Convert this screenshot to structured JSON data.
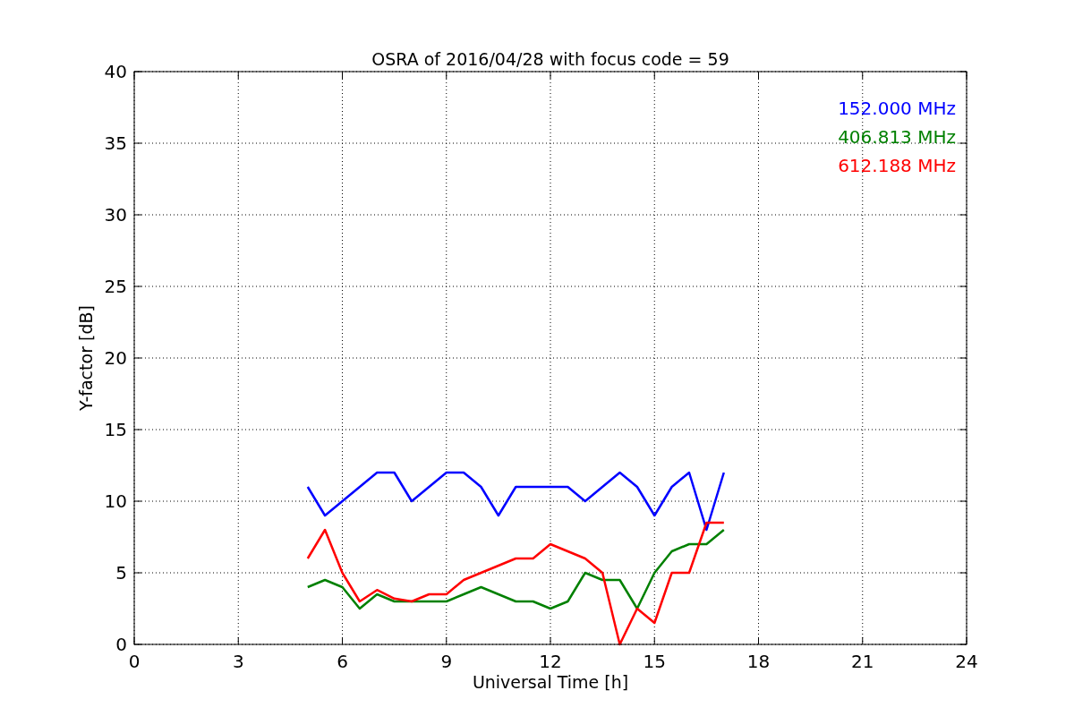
{
  "chart_data": {
    "type": "line",
    "title": "OSRA of 2016/04/28 with focus code = 59",
    "xlabel": "Universal Time [h]",
    "ylabel": "Y-factor [dB]",
    "x": [
      5,
      5.5,
      6,
      6.5,
      7,
      7.5,
      8,
      8.5,
      9,
      9.5,
      10,
      10.5,
      11,
      11.5,
      12,
      12.5,
      13,
      13.5,
      14,
      14.5,
      15,
      15.5,
      16,
      16.5,
      17
    ],
    "series": [
      {
        "name": "152.000 MHz",
        "color": "#0000ff",
        "values": [
          11,
          9,
          10,
          11,
          12,
          12,
          10,
          11,
          12,
          12,
          11,
          9,
          11,
          11,
          11,
          11,
          10,
          11,
          12,
          11,
          9,
          11,
          12,
          8,
          12
        ]
      },
      {
        "name": "406.813 MHz",
        "color": "#008000",
        "values": [
          4,
          4.5,
          4,
          2.5,
          3.5,
          3,
          3,
          3,
          3,
          3.5,
          4,
          3.5,
          3,
          3,
          2.5,
          3,
          5,
          4.5,
          4.5,
          2.5,
          5,
          6.5,
          7,
          7,
          8
        ]
      },
      {
        "name": "612.188 MHz",
        "color": "#ff0000",
        "values": [
          6,
          8,
          5,
          3,
          3.8,
          3.2,
          3,
          3.5,
          3.5,
          4.5,
          5,
          5.5,
          6,
          6,
          7,
          6.5,
          6,
          5,
          0,
          2.5,
          1.5,
          5,
          5,
          8.5,
          8.5
        ]
      }
    ],
    "xlim": [
      0,
      24
    ],
    "ylim": [
      0,
      40
    ],
    "xticks": [
      0,
      3,
      6,
      9,
      12,
      15,
      18,
      21,
      24
    ],
    "yticks": [
      0,
      5,
      10,
      15,
      20,
      25,
      30,
      35,
      40
    ],
    "grid": true
  }
}
